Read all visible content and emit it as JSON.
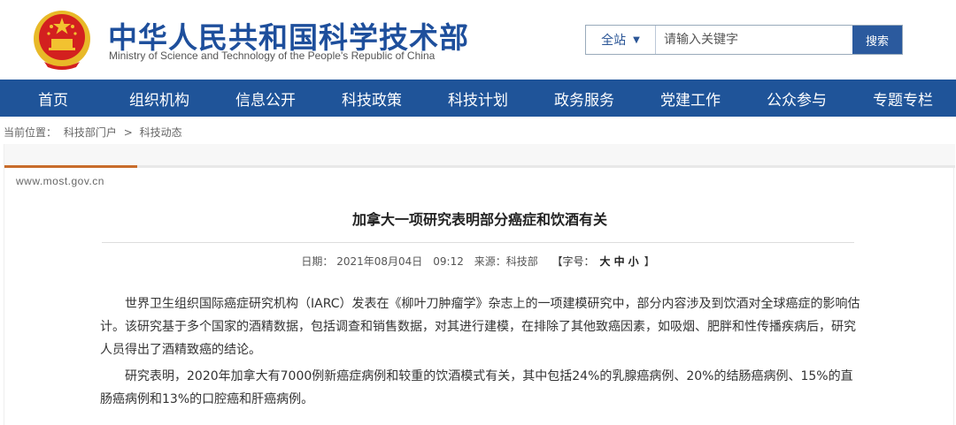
{
  "header": {
    "title_cn": "中华人民共和国科学技术部",
    "title_en": "Ministry of Science and Technology of the People's Republic of China",
    "emblem_icon": "national-emblem-icon"
  },
  "search": {
    "scope": "全站",
    "placeholder": "请输入关键字",
    "button": "搜索"
  },
  "nav": {
    "items": [
      "首页",
      "组织机构",
      "信息公开",
      "科技政策",
      "科技计划",
      "政务服务",
      "党建工作",
      "公众参与",
      "专题专栏"
    ]
  },
  "breadcrumb": {
    "label": "当前位置：",
    "items": [
      "科技部门户",
      ">",
      "科技动态"
    ]
  },
  "panel": {
    "site_url": "www.most.gov.cn"
  },
  "article": {
    "title": "加拿大一项研究表明部分癌症和饮酒有关",
    "meta": {
      "date": "日期： 2021年08月04日　09:12",
      "source": "来源：科技部",
      "font_size_label": "【字号：",
      "sizes": [
        "大",
        "中",
        "小"
      ],
      "font_size_end": "】"
    },
    "paragraphs": [
      "世界卫生组织国际癌症研究机构（IARC）发表在《柳叶刀肿瘤学》杂志上的一项建模研究中，部分内容涉及到饮酒对全球癌症的影响估计。该研究基于多个国家的酒精数据，包括调查和销售数据，对其进行建模，在排除了其他致癌因素，如吸烟、肥胖和性传播疾病后，研究人员得出了酒精致癌的结论。",
      "研究表明，2020年加拿大有7000例新癌症病例和较重的饮酒模式有关，其中包括24%的乳腺癌病例、20%的结肠癌病例、15%的直肠癌病例和13%的口腔癌和肝癌病例。"
    ]
  },
  "colors": {
    "brand_blue": "#1e4f9c",
    "nav_bg": "#1f5499",
    "accent_orange": "#c86c2b",
    "emblem_red": "#d3201f",
    "emblem_gold": "#f2c230"
  }
}
